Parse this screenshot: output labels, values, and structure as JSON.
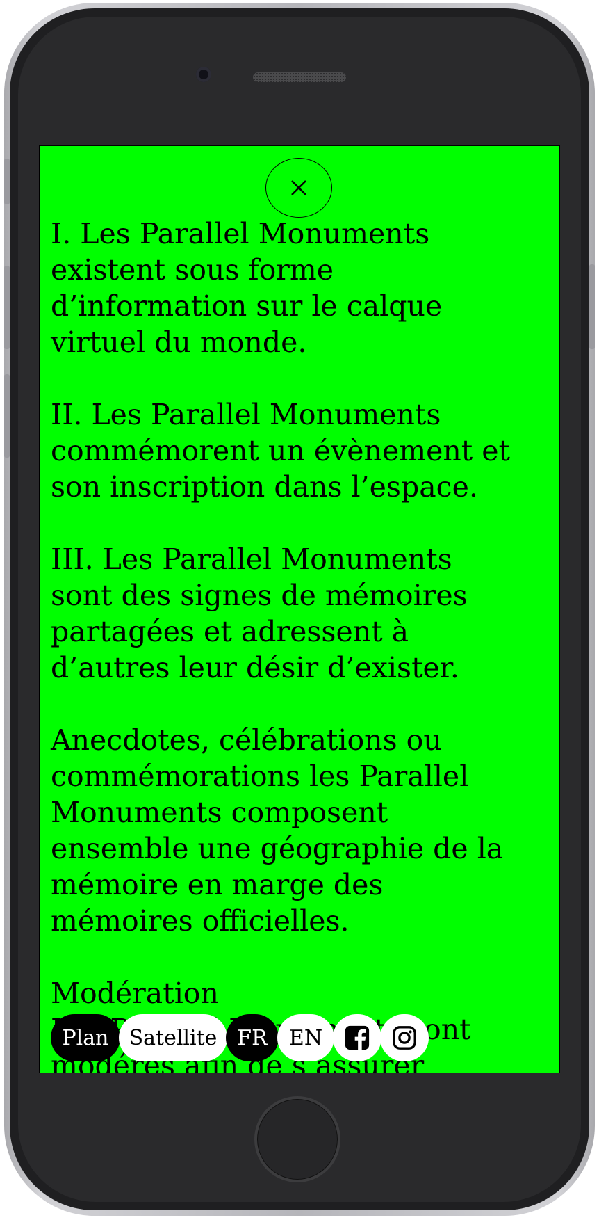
{
  "close": {
    "icon": "close-icon"
  },
  "content": {
    "paragraphs": [
      "I. Les Parallel Monuments\nexistent sous forme\nd’information sur le calque\nvirtuel du monde.",
      "II. Les Parallel Monuments\ncommémorent un évènement et\nson inscription dans l’espace.",
      "III. Les Parallel Monuments\nsont des signes de mémoires\npartagées et adressent à\nd’autres leur désir d’exister.",
      "Anecdotes, célébrations ou\ncommémorations les Parallel\nMonuments composent\nensemble une géographie de la\nmémoire en marge des\nmémoires officielles.",
      "Modération\nLes Parallel Monuments sont\nmodérés afin de s’assurer"
    ]
  },
  "bottom_bar": {
    "plan": "Plan",
    "satellite": "Satellite",
    "fr": "FR",
    "en": "EN",
    "facebook_icon": "facebook-icon",
    "instagram_icon": "instagram-icon"
  },
  "colors": {
    "screen_background": "#00ff00",
    "active_pill": "#000000",
    "inactive_pill": "#ffffff"
  }
}
